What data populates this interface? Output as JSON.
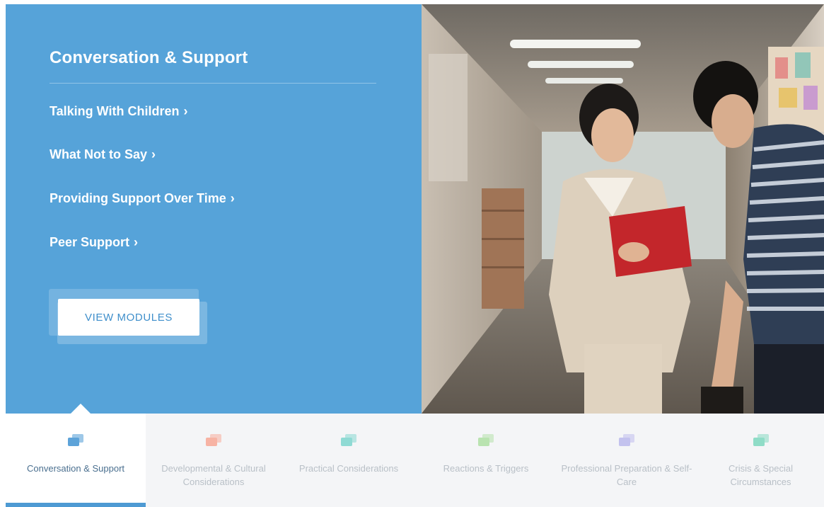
{
  "panel": {
    "title": "Conversation & Support",
    "links": [
      {
        "label": "Talking With Children",
        "chevron": "›"
      },
      {
        "label": "What Not to Say",
        "chevron": "›"
      },
      {
        "label": "Providing Support Over Time",
        "chevron": "›"
      },
      {
        "label": "Peer Support",
        "chevron": "›"
      }
    ],
    "button_label": "VIEW MODULES"
  },
  "tabs": [
    {
      "label": "Conversation & Support",
      "icon": "speech-bubbles-icon",
      "color": "#5da3d9",
      "active": true
    },
    {
      "label": "Developmental & Cultural Considerations",
      "icon": "speech-bubbles-icon",
      "color": "#f7b3a4",
      "active": false
    },
    {
      "label": "Practical Considerations",
      "icon": "speech-bubbles-icon",
      "color": "#8fdad4",
      "active": false
    },
    {
      "label": "Reactions & Triggers",
      "icon": "speech-bubbles-icon",
      "color": "#b9e3b0",
      "active": false
    },
    {
      "label": "Professional Preparation & Self-Care",
      "icon": "speech-bubbles-icon",
      "color": "#c3c2ee",
      "active": false
    },
    {
      "label": "Crisis & Special Circumstances",
      "icon": "speech-bubbles-icon",
      "color": "#8fdcc7",
      "active": false
    }
  ],
  "colors": {
    "panel_blue": "#56a3d9",
    "active_bar": "#4e9ad3",
    "tab_bg": "#f4f5f7"
  }
}
